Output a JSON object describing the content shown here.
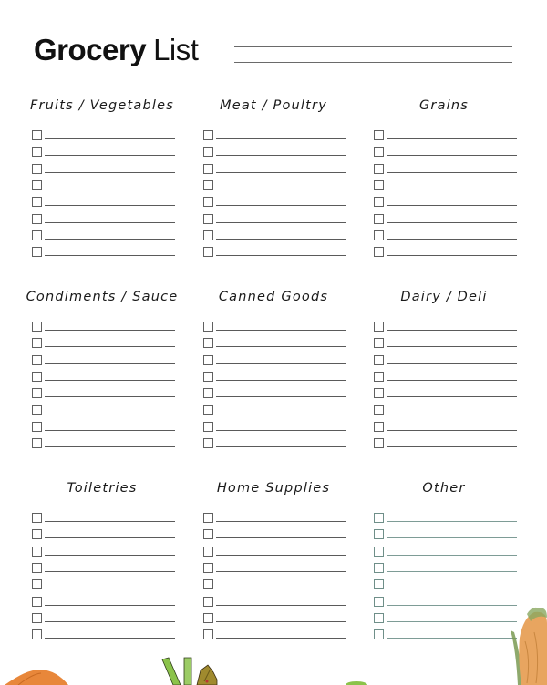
{
  "header": {
    "title_bold": "Grocery",
    "title_light": "List"
  },
  "sections": [
    {
      "title": "Fruits / Vegetables",
      "rows": 8
    },
    {
      "title": "Meat / Poultry",
      "rows": 8
    },
    {
      "title": "Grains",
      "rows": 8
    },
    {
      "title": "Condiments / Sauce",
      "rows": 8
    },
    {
      "title": "Canned Goods",
      "rows": 8
    },
    {
      "title": "Dairy / Deli",
      "rows": 8
    },
    {
      "title": "Toiletries",
      "rows": 8
    },
    {
      "title": "Home Supplies",
      "rows": 8
    },
    {
      "title": "Other",
      "rows": 8
    }
  ],
  "colors": {
    "text": "#111111",
    "line": "#5a5a5a",
    "other_accent": "#7e9c96",
    "decor_orange": "#e8873a",
    "decor_green": "#7cb342"
  },
  "decorations": [
    "pumpkin-illustration",
    "leek-illustration",
    "corn-illustration",
    "green-vegetable-illustration"
  ]
}
